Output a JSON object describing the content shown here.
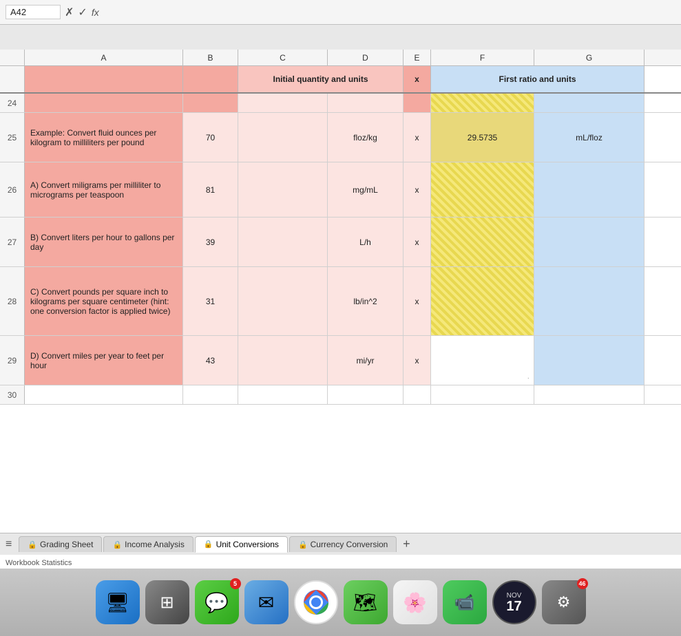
{
  "formula_bar": {
    "cell_ref": "A42",
    "icons": [
      "✓",
      "✗",
      "fx"
    ]
  },
  "columns": {
    "headers": [
      "A",
      "B",
      "C",
      "D",
      "E",
      "F",
      "G"
    ]
  },
  "header_row": {
    "label_cd": "Initial quantity and units",
    "label_e": "x",
    "label_fg": "First ratio and units"
  },
  "rows": {
    "row24": {
      "num": "24",
      "cells": [
        "",
        "",
        "",
        "",
        "",
        "",
        ""
      ]
    },
    "row25": {
      "num": "25",
      "label": "Example: Convert fluid ounces per kilogram to milliliters per pound",
      "b": "70",
      "d": "floz/kg",
      "e": "x",
      "f": "29.5735",
      "g": "mL/floz"
    },
    "row26": {
      "num": "26",
      "label": "A) Convert miligrams per milliliter to micrograms per teaspoon",
      "b": "81",
      "d": "mg/mL",
      "e": "x",
      "f": "",
      "g": ""
    },
    "row27": {
      "num": "27",
      "label": "B) Convert liters per hour to gallons per day",
      "b": "39",
      "d": "L/h",
      "e": "x",
      "f": "",
      "g": ""
    },
    "row28": {
      "num": "28",
      "label": "C) Convert pounds per square inch to kilograms per square centimeter (hint: one conversion factor is applied twice)",
      "b": "31",
      "d": "lb/in^2",
      "e": "x",
      "f": "",
      "g": ""
    },
    "row29": {
      "num": "29",
      "label": "D) Convert miles per year to feet per hour",
      "b": "43",
      "d": "mi/yr",
      "e": "x",
      "f": "",
      "g": ""
    },
    "row30": {
      "num": "30"
    }
  },
  "tabs": [
    {
      "id": "grading",
      "label": "Grading Sheet",
      "active": false
    },
    {
      "id": "income",
      "label": "Income Analysis",
      "active": false
    },
    {
      "id": "unit",
      "label": "Unit Conversions",
      "active": true
    },
    {
      "id": "currency",
      "label": "Currency Conversion",
      "active": false
    }
  ],
  "workbook_stats": "Workbook Statistics",
  "dock": {
    "items": [
      {
        "id": "finder",
        "emoji": "🖥",
        "bg": "#4a9de8",
        "label": "Finder"
      },
      {
        "id": "launchpad",
        "emoji": "⊞",
        "bg": "#555",
        "label": "Launchpad"
      },
      {
        "id": "messages",
        "emoji": "💬",
        "bg": "#2ea81c",
        "label": "Messages",
        "badge": "5"
      },
      {
        "id": "mail",
        "emoji": "✉",
        "bg": "#2570c4",
        "label": "Mail"
      },
      {
        "id": "chrome",
        "emoji": "◎",
        "bg": "#fff",
        "label": "Chrome"
      },
      {
        "id": "maps",
        "emoji": "🗺",
        "bg": "#3da830",
        "label": "Maps"
      },
      {
        "id": "photos",
        "emoji": "🌸",
        "bg": "#f0f0f0",
        "label": "Photos"
      },
      {
        "id": "facetime",
        "emoji": "📹",
        "bg": "#2ba840",
        "label": "FaceTime"
      }
    ],
    "clock": {
      "month": "NOV",
      "day": "17"
    },
    "notification_icon": {
      "badge": "46"
    }
  }
}
